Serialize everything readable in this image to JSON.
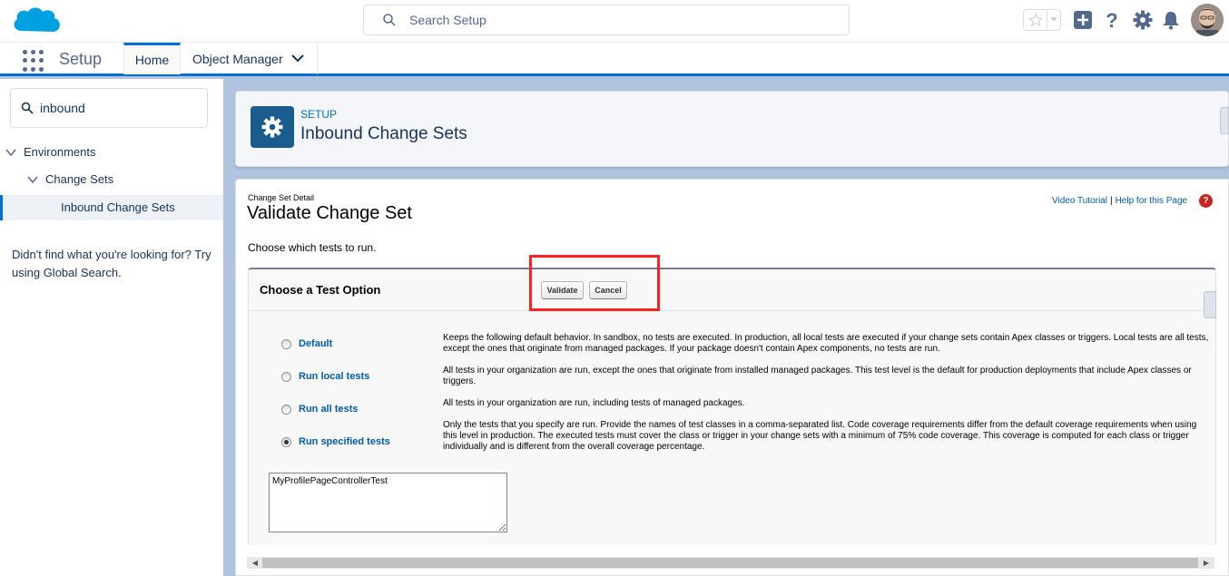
{
  "header": {
    "search_placeholder": "Search Setup",
    "icons": [
      "salesforce-cloud-logo",
      "star-icon",
      "add-icon",
      "help-icon",
      "gear-icon",
      "bell-icon"
    ]
  },
  "context": {
    "app_name": "Setup",
    "tabs": [
      {
        "label": "Home",
        "active": true
      },
      {
        "label": "Object Manager",
        "active": false
      }
    ]
  },
  "sidebar": {
    "search_value": "inbound",
    "tree": [
      {
        "label": "Environments",
        "level": 0,
        "expanded": true
      },
      {
        "label": "Change Sets",
        "level": 1,
        "expanded": true
      },
      {
        "label": "Inbound Change Sets",
        "level": 2,
        "selected": true
      }
    ],
    "not_found_text": "Didn't find what you're looking for? Try using Global Search."
  },
  "page_header": {
    "eyebrow": "SETUP",
    "title": "Inbound Change Sets"
  },
  "detail": {
    "eyebrow": "Change Set Detail",
    "title": "Validate Change Set",
    "help_links": [
      "Video Tutorial",
      "Help for this Page"
    ],
    "help_separator": "|",
    "help_badge": "?",
    "instructions": "Choose which tests to run.",
    "section_title": "Choose a Test Option",
    "buttons": {
      "validate": "Validate",
      "cancel": "Cancel"
    },
    "options": [
      {
        "label": "Default",
        "checked": false,
        "description": "Keeps the following default behavior. In sandbox, no tests are executed. In production, all local tests are executed if your change sets contain Apex classes or triggers. Local tests are all tests, except the ones that originate from managed packages. If your package doesn't contain Apex components, no tests are run."
      },
      {
        "label": "Run local tests",
        "checked": false,
        "description": "All tests in your organization are run, except the ones that originate from installed managed packages. This test level is the default for production deployments that include Apex classes or triggers."
      },
      {
        "label": "Run all tests",
        "checked": false,
        "description": "All tests in your organization are run, including tests of managed packages."
      },
      {
        "label": "Run specified tests",
        "checked": true,
        "description": "Only the tests that you specify are run. Provide the names of test classes in a comma-separated list. Code coverage requirements differ from the default coverage requirements when using this level in production. The executed tests must cover the class or trigger in your change sets with a minimum of 75% code coverage. This coverage is computed for each class or trigger individually and is different from the overall coverage percentage."
      }
    ],
    "test_classes_value": "MyProfilePageControllerTest"
  },
  "colors": {
    "brand_blue": "#0070d2",
    "highlight_red": "#ff2020",
    "link_blue": "#015ba7"
  }
}
